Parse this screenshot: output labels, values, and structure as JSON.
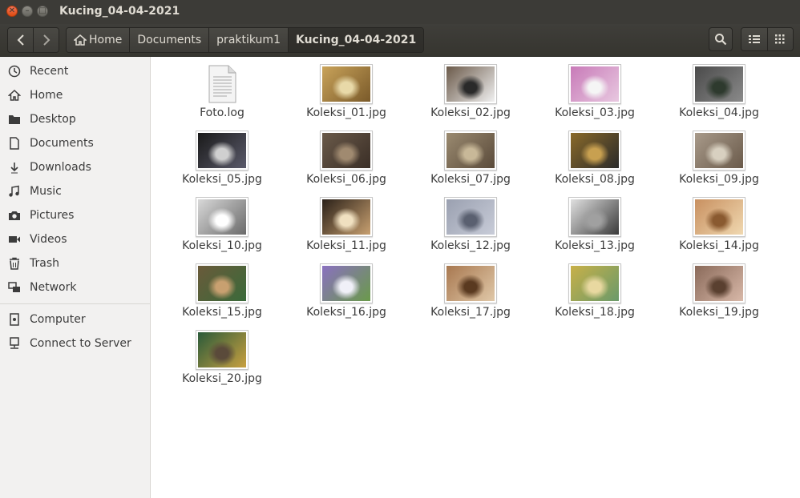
{
  "window": {
    "title": "Kucing_04-04-2021"
  },
  "toolbar": {
    "back_icon": "chevron-left-icon",
    "forward_icon": "chevron-right-icon",
    "breadcrumbs": [
      "Home",
      "Documents",
      "praktikum1",
      "Kucing_04-04-2021"
    ],
    "search_icon": "search-icon",
    "list_view_icon": "list-view-icon",
    "grid_view_icon": "grid-view-icon"
  },
  "sidebar": {
    "items": [
      {
        "label": "Recent",
        "icon": "clock-icon"
      },
      {
        "label": "Home",
        "icon": "home-icon"
      },
      {
        "label": "Desktop",
        "icon": "folder-icon"
      },
      {
        "label": "Documents",
        "icon": "document-icon"
      },
      {
        "label": "Downloads",
        "icon": "download-icon"
      },
      {
        "label": "Music",
        "icon": "music-icon"
      },
      {
        "label": "Pictures",
        "icon": "camera-icon"
      },
      {
        "label": "Videos",
        "icon": "video-icon"
      },
      {
        "label": "Trash",
        "icon": "trash-icon"
      },
      {
        "label": "Network",
        "icon": "network-icon"
      }
    ],
    "devices": [
      {
        "label": "Computer",
        "icon": "computer-icon"
      },
      {
        "label": "Connect to Server",
        "icon": "server-icon"
      }
    ]
  },
  "files": [
    {
      "name": "Foto.log",
      "type": "text-file-icon"
    },
    {
      "name": "Koleksi_01.jpg",
      "type": "image",
      "colors": [
        "#c9a35a",
        "#7a5a2a",
        "#e8d9a8"
      ]
    },
    {
      "name": "Koleksi_02.jpg",
      "type": "image",
      "colors": [
        "#6b5a4a",
        "#f0f0f0",
        "#2a2a2a"
      ]
    },
    {
      "name": "Koleksi_03.jpg",
      "type": "image",
      "colors": [
        "#c87ab8",
        "#e8c8e0",
        "#f5f5f5"
      ]
    },
    {
      "name": "Koleksi_04.jpg",
      "type": "image",
      "colors": [
        "#4a4a4a",
        "#8a8a8a",
        "#2e3a2e"
      ]
    },
    {
      "name": "Koleksi_05.jpg",
      "type": "image",
      "colors": [
        "#1a1a1a",
        "#5a5a6a",
        "#d0d0d0"
      ]
    },
    {
      "name": "Koleksi_06.jpg",
      "type": "image",
      "colors": [
        "#6a5a4a",
        "#3a2e26",
        "#a08a70"
      ]
    },
    {
      "name": "Koleksi_07.jpg",
      "type": "image",
      "colors": [
        "#9a8a70",
        "#5a4a3a",
        "#c8b898"
      ]
    },
    {
      "name": "Koleksi_08.jpg",
      "type": "image",
      "colors": [
        "#8a6a2a",
        "#2a2a2a",
        "#c8a050"
      ]
    },
    {
      "name": "Koleksi_09.jpg",
      "type": "image",
      "colors": [
        "#a89a8a",
        "#6a5a4a",
        "#d8d0c0"
      ]
    },
    {
      "name": "Koleksi_10.jpg",
      "type": "image",
      "colors": [
        "#d8d8d8",
        "#6a6a6a",
        "#ffffff"
      ]
    },
    {
      "name": "Koleksi_11.jpg",
      "type": "image",
      "colors": [
        "#2a2018",
        "#c8a070",
        "#f0e0c0"
      ]
    },
    {
      "name": "Koleksi_12.jpg",
      "type": "image",
      "colors": [
        "#9aa0b0",
        "#c8ccd8",
        "#5a6070"
      ]
    },
    {
      "name": "Koleksi_13.jpg",
      "type": "image",
      "colors": [
        "#e0e0e0",
        "#3a3a3a",
        "#a0a0a0"
      ]
    },
    {
      "name": "Koleksi_14.jpg",
      "type": "image",
      "colors": [
        "#c89060",
        "#f0d8b0",
        "#8a5a30"
      ]
    },
    {
      "name": "Koleksi_15.jpg",
      "type": "image",
      "colors": [
        "#6a5a3a",
        "#3a6a3a",
        "#c8a070"
      ]
    },
    {
      "name": "Koleksi_16.jpg",
      "type": "image",
      "colors": [
        "#8a70c0",
        "#6a9a4a",
        "#f0f0f8"
      ]
    },
    {
      "name": "Koleksi_17.jpg",
      "type": "image",
      "colors": [
        "#a87850",
        "#e0c8a8",
        "#5a3a20"
      ]
    },
    {
      "name": "Koleksi_18.jpg",
      "type": "image",
      "colors": [
        "#c8b048",
        "#6a9a6a",
        "#e8d8a0"
      ]
    },
    {
      "name": "Koleksi_19.jpg",
      "type": "image",
      "colors": [
        "#8a6a5a",
        "#d8b8a8",
        "#5a4030"
      ]
    },
    {
      "name": "Koleksi_20.jpg",
      "type": "image",
      "colors": [
        "#2a5a3a",
        "#c8a040",
        "#5a4a3a"
      ]
    }
  ]
}
